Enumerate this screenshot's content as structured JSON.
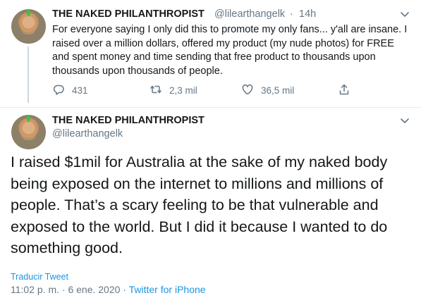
{
  "tweet1": {
    "display_name": "THE NAKED PHILANTHROPIST",
    "handle": "@lilearthangelk",
    "separator": "·",
    "time": "14h",
    "text": "For everyone saying I only did this to promote my only fans... y'all are insane. I raised over a million dollars, offered my product (my nude photos) for FREE and spent money and time sending that free product to thousands upon thousands upon thousands of people.",
    "replies": "431",
    "retweets": "2,3 mil",
    "likes": "36,5 mil"
  },
  "tweet2": {
    "display_name": "THE NAKED PHILANTHROPIST",
    "handle": "@lilearthangelk",
    "text": "I raised $1mil for Australia at the sake of my naked body being exposed on the internet to millions and millions of people. That’s a scary feeling to be that vulnerable and exposed to the world. But I did it because I wanted to do something good.",
    "translate_label": "Traducir Tweet",
    "timestamp": "11:02 p. m. · 6 ene. 2020",
    "separator": "·",
    "source": "Twitter for iPhone"
  },
  "icons": {
    "reply": "reply-icon",
    "retweet": "retweet-icon",
    "like": "heart-icon",
    "share": "share-icon",
    "more": "chevron-down-icon"
  },
  "colors": {
    "link": "#1b95e0",
    "muted": "#657786",
    "text": "#14171a",
    "thread_line": "#ccd6dd"
  }
}
